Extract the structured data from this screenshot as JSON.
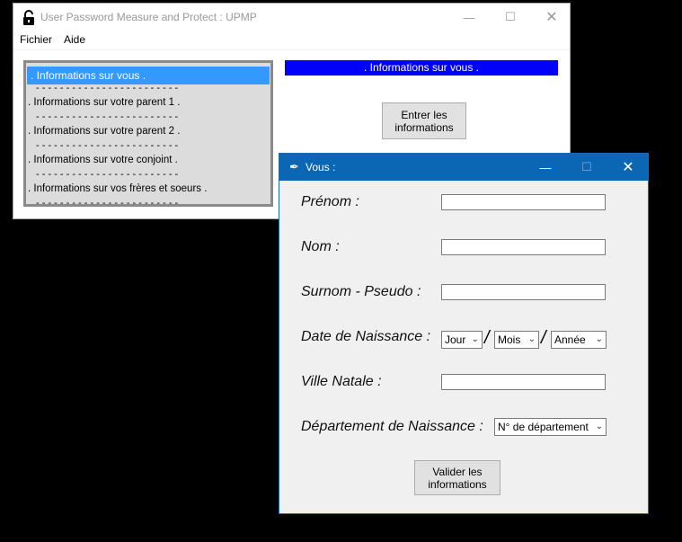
{
  "main_window": {
    "title": "User Password Measure and Protect : UPMP",
    "menu": [
      "Fichier",
      "Aide"
    ],
    "list_items": [
      ". Informations sur vous .",
      "- - - - - - - - - - - - - - - - - - - - - - - -",
      ". Informations sur votre parent 1 .",
      "- - - - - - - - - - - - - - - - - - - - - - - -",
      ". Informations sur votre parent 2 .",
      "- - - - - - - - - - - - - - - - - - - - - - - -",
      ". Informations sur votre conjoint .",
      "- - - - - - - - - - - - - - - - - - - - - - - -",
      ". Informations sur vos frères et soeurs .",
      "- - - - - - - - - - - - - - - - - - - - - - - -"
    ],
    "selected_index": 0,
    "heading": ". Informations sur vous .",
    "enter_button": "Entrer les informations"
  },
  "dialog": {
    "title": "Vous :",
    "labels": {
      "prenom": "Prénom :",
      "nom": "Nom :",
      "surnom": "Surnom - Pseudo :",
      "date": "Date de Naissance :",
      "ville": "Ville Natale :",
      "departement": "Département de Naissance :"
    },
    "values": {
      "prenom": "",
      "nom": "",
      "surnom": "",
      "ville": ""
    },
    "date_selects": {
      "jour": "Jour",
      "mois": "Mois",
      "annee": "Année",
      "separator": "/"
    },
    "departement_select": "N° de département",
    "validate_button": "Valider les informations"
  },
  "colors": {
    "heading_bg": "#0000ff",
    "selection": "#3399ff",
    "dialog_title": "#0b66b4"
  }
}
